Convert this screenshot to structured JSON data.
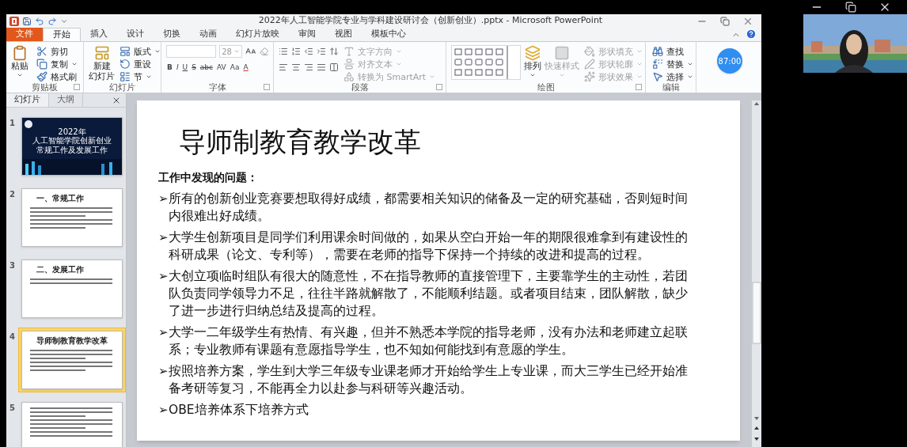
{
  "window": {
    "title": "2022年人工智能学院专业与学科建设研讨会（创新创业）.pptx - Microsoft PowerPoint"
  },
  "tabs": [
    {
      "label": "文件",
      "kind": "file",
      "selected": false
    },
    {
      "label": "开始",
      "kind": "tab",
      "selected": true
    },
    {
      "label": "插入",
      "kind": "tab",
      "selected": false
    },
    {
      "label": "设计",
      "kind": "tab",
      "selected": false
    },
    {
      "label": "切换",
      "kind": "tab",
      "selected": false
    },
    {
      "label": "动画",
      "kind": "tab",
      "selected": false
    },
    {
      "label": "幻灯片放映",
      "kind": "tab",
      "selected": false
    },
    {
      "label": "审阅",
      "kind": "tab",
      "selected": false
    },
    {
      "label": "视图",
      "kind": "tab",
      "selected": false
    },
    {
      "label": "模板中心",
      "kind": "tab",
      "selected": false
    }
  ],
  "ribbon": {
    "clipboard": {
      "label": "剪贴板",
      "large": "粘贴",
      "items": [
        {
          "label": "剪切",
          "dropdown": false,
          "disabled": false
        },
        {
          "label": "复制",
          "dropdown": true,
          "disabled": false
        },
        {
          "label": "格式刷",
          "dropdown": false,
          "disabled": false
        }
      ]
    },
    "slides": {
      "label": "幻灯片",
      "large": [
        "新建",
        "幻灯片"
      ],
      "items": [
        {
          "label": "版式",
          "dropdown": true,
          "disabled": false
        },
        {
          "label": "重设",
          "dropdown": false,
          "disabled": false
        },
        {
          "label": "节",
          "dropdown": true,
          "disabled": false
        }
      ]
    },
    "font": {
      "label": "字体",
      "size": "28",
      "format_buttons": [
        "B",
        "I",
        "U",
        "S",
        "abc",
        "AV",
        "Aa",
        "A"
      ]
    },
    "paragraph": {
      "label": "段落",
      "items": [
        {
          "label": "文字方向",
          "dropdown": true,
          "disabled": true
        },
        {
          "label": "对齐文本",
          "dropdown": true,
          "disabled": true
        },
        {
          "label": "转换为 SmartArt",
          "dropdown": true,
          "disabled": true
        }
      ]
    },
    "drawing": {
      "label": "绘图",
      "arrange": "排列",
      "quick_styles": {
        "label": "快速样式",
        "disabled": true
      },
      "items": [
        {
          "label": "形状填充",
          "dropdown": true,
          "disabled": true
        },
        {
          "label": "形状轮廓",
          "dropdown": true,
          "disabled": true
        },
        {
          "label": "形状效果",
          "dropdown": true,
          "disabled": true
        }
      ]
    },
    "editing": {
      "label": "编辑",
      "items": [
        {
          "label": "查找",
          "dropdown": false,
          "disabled": false
        },
        {
          "label": "替换",
          "dropdown": true,
          "disabled": false
        },
        {
          "label": "选择",
          "dropdown": true,
          "disabled": false
        }
      ]
    }
  },
  "timer": "87:00",
  "pane_tabs": [
    {
      "label": "幻灯片",
      "selected": true
    },
    {
      "label": "大纲",
      "selected": false
    }
  ],
  "thumbnails": [
    {
      "number": "1",
      "kind": "cover",
      "selected": false,
      "lines": [
        "2022年",
        "人工智能学院创新创业常规工作及发展工作"
      ]
    },
    {
      "number": "2",
      "kind": "content",
      "selected": false,
      "lines": [
        "一、常规工作"
      ]
    },
    {
      "number": "3",
      "kind": "content",
      "selected": false,
      "lines": [
        "二、发展工作"
      ]
    },
    {
      "number": "4",
      "kind": "content",
      "selected": true,
      "lines": [
        "导师制教育教学改革"
      ]
    },
    {
      "number": "5",
      "kind": "text",
      "selected": false
    }
  ],
  "slide": {
    "title": "导师制教育教学改革",
    "subtitle": "工作中发现的问题：",
    "bullets": [
      {
        "marker": "➢",
        "text": "所有的创新创业竞赛要想取得好成绩，都需要相关知识的储备及一定的研究基础，否则短时间内很难出好成绩。"
      },
      {
        "marker": "➢",
        "text": "大学生创新项目是同学们利用课余时间做的，如果从空白开始一年的期限很难拿到有建设性的科研成果（论文、专利等），需要在老师的指导下保持一个持续的改进和提高的过程。"
      },
      {
        "marker": "➢",
        "text": "大创立项临时组队有很大的随意性，不在指导教师的直接管理下，主要靠学生的主动性，若团队负责同学领导力不足，往往半路就解散了，不能顺利结题。或者项目结束，团队解散，缺少了进一步进行归纳总结及提高的过程。"
      },
      {
        "marker": "➢",
        "text": "大学一二年级学生有热情、有兴趣，但并不熟悉本学院的指导老师，没有办法和老师建立起联系；专业教师有课题有意愿指导学生，也不知如何能找到有意愿的学生。"
      },
      {
        "marker": "➢",
        "text": "按照培养方案，学生到大学三年级专业课老师才开始给学生上专业课，而大三学生已经开始准备考研等复习，不能再全力以赴参与科研等兴趣活动。"
      },
      {
        "marker": "➢",
        "text": "OBE培养体系下培养方式"
      }
    ]
  }
}
